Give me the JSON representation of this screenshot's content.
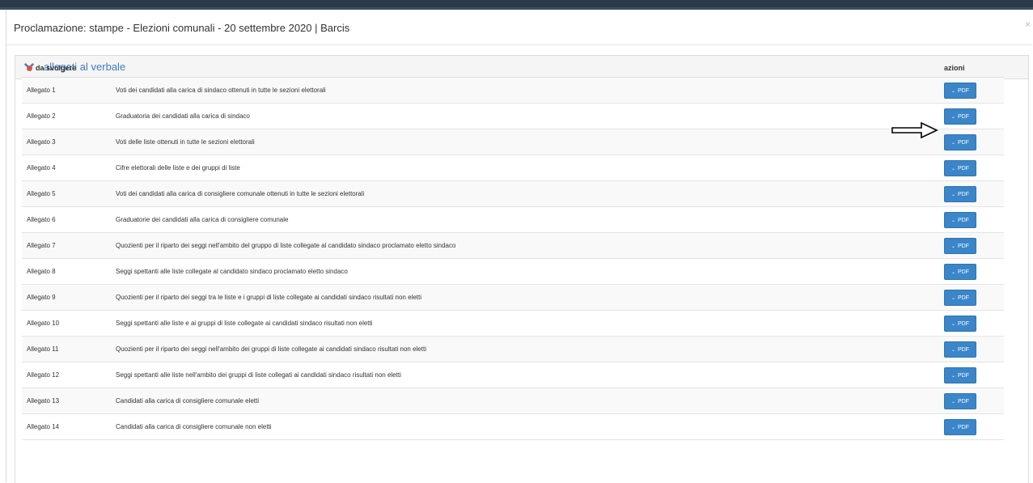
{
  "modal": {
    "title": "Proclamazione: stampe - Elezioni comunali - 20 settembre 2020 |  Barcis",
    "close_icon": "close-icon"
  },
  "panel": {
    "title": "allegati al verbale",
    "icon": "chevron-down-icon"
  },
  "table": {
    "header_left": "da svolgere",
    "header_right": "azioni",
    "status_color": "#d9534f",
    "accent_color": "#3a86c8",
    "rows": [
      {
        "name": "Allegato 1",
        "desc": "Voti dei candidati alla carica di sindaco ottenuti in tutte le sezioni elettorali",
        "action": "PDF"
      },
      {
        "name": "Allegato 2",
        "desc": "Graduatoria dei candidati alla carica di sindaco",
        "action": "PDF"
      },
      {
        "name": "Allegato 3",
        "desc": "Voti delle liste ottenuti in tutte le sezioni elettorali",
        "action": "PDF"
      },
      {
        "name": "Allegato 4",
        "desc": "Cifre elettorali delle liste e dei gruppi di liste",
        "action": "PDF"
      },
      {
        "name": "Allegato 5",
        "desc": "Voti dei candidati alla carica di consigliere comunale ottenuti in tutte le sezioni elettorali",
        "action": "PDF"
      },
      {
        "name": "Allegato 6",
        "desc": "Graduatorie dei candidati alla carica di consigliere comunale",
        "action": "PDF"
      },
      {
        "name": "Allegato 7",
        "desc": "Quozienti per il riparto dei seggi nell'ambito del gruppo di liste collegate al candidato sindaco proclamato eletto sindaco",
        "action": "PDF"
      },
      {
        "name": "Allegato 8",
        "desc": "Seggi spettanti alle liste collegate al candidato sindaco proclamato eletto sindaco",
        "action": "PDF"
      },
      {
        "name": "Allegato 9",
        "desc": "Quozienti per il riparto dei seggi tra le liste e i gruppi di liste collegate ai candidati sindaco risultati non eletti",
        "action": "PDF"
      },
      {
        "name": "Allegato 10",
        "desc": "Seggi spettanti alle liste e ai gruppi di liste collegate ai candidati sindaco risultati non eletti",
        "action": "PDF"
      },
      {
        "name": "Allegato 11",
        "desc": "Quozienti per il riparto dei seggi nell'ambito dei gruppi di liste collegate ai candidati sindaco risultati non eletti",
        "action": "PDF"
      },
      {
        "name": "Allegato 12",
        "desc": "Seggi spettanti alle liste nell'ambito dei gruppi di liste collegati ai candidati sindaco risultati non eletti",
        "action": "PDF"
      },
      {
        "name": "Allegato 13",
        "desc": "Candidati alla carica di consigliere comunale eletti",
        "action": "PDF"
      },
      {
        "name": "Allegato 14",
        "desc": "Candidati alla carica di consigliere comunale non eletti",
        "action": "PDF"
      }
    ]
  },
  "annotation": {
    "icon": "arrow-right-icon"
  }
}
